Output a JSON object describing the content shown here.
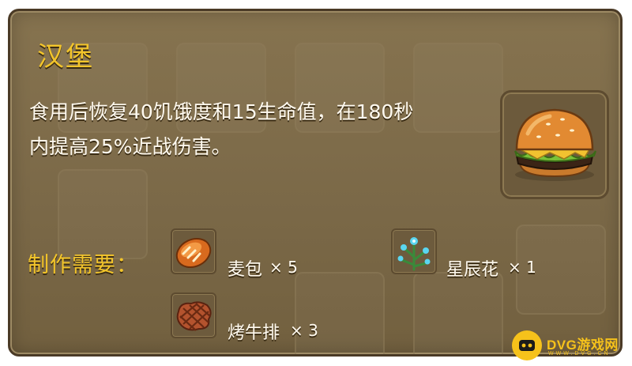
{
  "item": {
    "title": "汉堡",
    "description_line1": "食用后恢复40饥饿度和15生命值，在180秒",
    "description_line2": "内提高25%近战伤害。",
    "icon": "hamburger-icon"
  },
  "recipe": {
    "label": "制作需要：",
    "ingredients": [
      {
        "name": "麦包",
        "qty": "× 5",
        "icon": "bread-icon"
      },
      {
        "name": "星辰花",
        "qty": "× 1",
        "icon": "star-flower-icon"
      },
      {
        "name": "烤牛排",
        "qty": "× 3",
        "icon": "steak-icon"
      }
    ]
  },
  "watermark": {
    "text": "DVG游戏网",
    "sub": "WWW.DVG.CN"
  },
  "colors": {
    "title": "#f3c52a",
    "panel": "#7b6948",
    "border": "#4a3a26",
    "text": "#fffaf0",
    "watermark": "#f6c21b"
  }
}
